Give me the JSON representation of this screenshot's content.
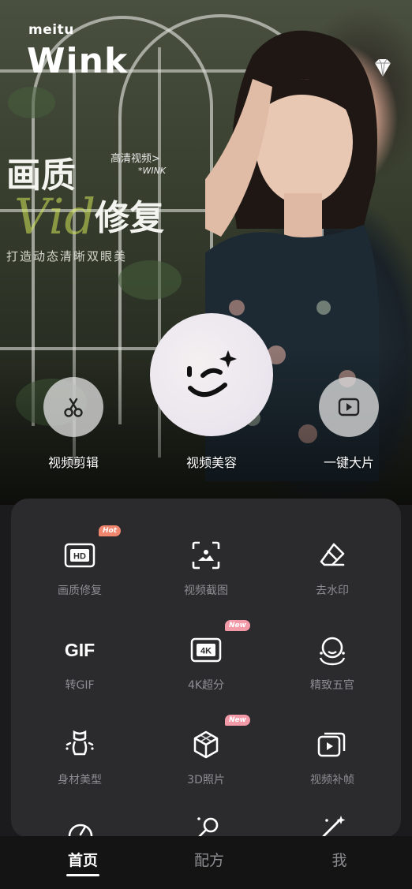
{
  "brand": {
    "small": "meitu",
    "big": "Wink"
  },
  "promo": {
    "title_line1": "画质",
    "title_line2": "修复",
    "tag": "高清视频>",
    "tag2": "*WINK",
    "script": "Vid",
    "subtitle": "打造动态清晰双眼美"
  },
  "actions": [
    {
      "label": "视频剪辑",
      "icon": "scissors-icon"
    },
    {
      "label": "视频美容",
      "icon": "wink-face-icon"
    },
    {
      "label": "一键大片",
      "icon": "play-icon"
    }
  ],
  "tools": [
    {
      "label": "画质修复",
      "icon": "hd-icon",
      "badge": "Hot"
    },
    {
      "label": "视频截图",
      "icon": "screenshot-frame-icon",
      "badge": ""
    },
    {
      "label": "去水印",
      "icon": "eraser-icon",
      "badge": ""
    },
    {
      "label": "转GIF",
      "icon": "gif-icon",
      "icon_text": "GIF",
      "badge": ""
    },
    {
      "label": "4K超分",
      "icon": "4k-icon",
      "icon_text": "4K",
      "badge": "New"
    },
    {
      "label": "精致五官",
      "icon": "face-features-icon",
      "badge": ""
    },
    {
      "label": "身材美型",
      "icon": "body-shape-icon",
      "badge": ""
    },
    {
      "label": "3D照片",
      "icon": "cube-icon",
      "badge": "New"
    },
    {
      "label": "视频补帧",
      "icon": "frame-interpolation-icon",
      "badge": ""
    }
  ],
  "tabs": [
    {
      "label": "首页",
      "active": true
    },
    {
      "label": "配方",
      "active": false
    },
    {
      "label": "我",
      "active": false
    }
  ],
  "colors": {
    "badge_hot": "#f0866e",
    "badge_new": "#f39aa8",
    "panel_bg": "#2b2b2d"
  }
}
